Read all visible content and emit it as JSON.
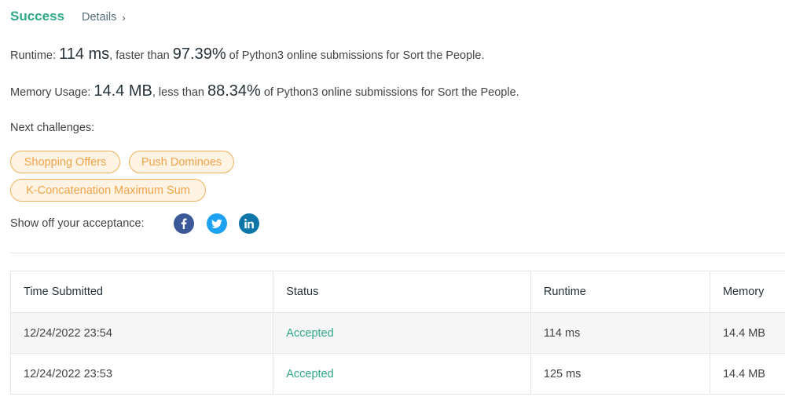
{
  "header": {
    "status": "Success",
    "details_label": "Details"
  },
  "runtime": {
    "label": "Runtime:",
    "value": "114 ms",
    "comparison": ", faster than ",
    "percent": "97.39%",
    "suffix": " of Python3 online submissions for Sort the People."
  },
  "memory": {
    "label": "Memory Usage:",
    "value": "14.4 MB",
    "comparison": ", less than ",
    "percent": "88.34%",
    "suffix": " of Python3 online submissions for Sort the People."
  },
  "next_challenges": {
    "label": "Next challenges:",
    "items": [
      "Shopping Offers",
      "Push Dominoes",
      "K-Concatenation Maximum Sum"
    ]
  },
  "share": {
    "label": "Show off your acceptance:",
    "icons": [
      "facebook-icon",
      "twitter-icon",
      "linkedin-icon"
    ]
  },
  "table": {
    "headers": [
      "Time Submitted",
      "Status",
      "Runtime",
      "Memory"
    ],
    "rows": [
      {
        "time": "12/24/2022 23:54",
        "status": "Accepted",
        "runtime": "114 ms",
        "memory": "14.4 MB"
      },
      {
        "time": "12/24/2022 23:53",
        "status": "Accepted",
        "runtime": "125 ms",
        "memory": "14.4 MB"
      }
    ]
  },
  "colors": {
    "success": "#2ea88a",
    "chip_border": "#f0b05a",
    "chip_text": "#f0a24a"
  }
}
